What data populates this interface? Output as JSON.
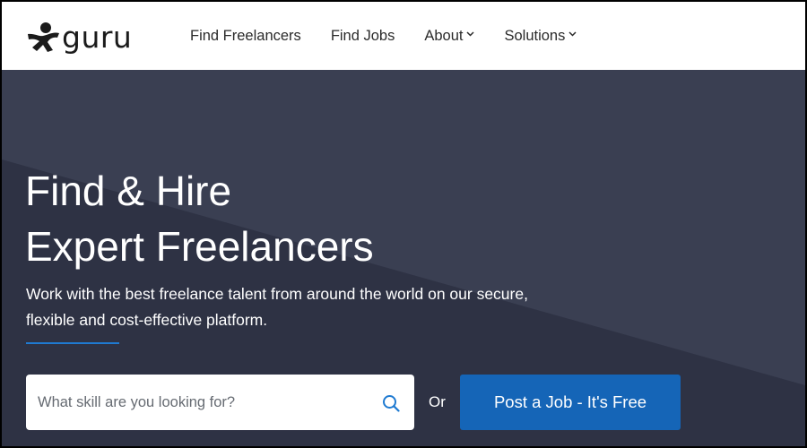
{
  "brand": {
    "name": "guru"
  },
  "nav": {
    "items": [
      {
        "label": "Find Freelancers",
        "has_dropdown": false
      },
      {
        "label": "Find Jobs",
        "has_dropdown": false
      },
      {
        "label": "About",
        "has_dropdown": true
      },
      {
        "label": "Solutions",
        "has_dropdown": true
      }
    ]
  },
  "hero": {
    "title_line1": "Find & Hire",
    "title_line2": "Expert Freelancers",
    "subtitle_line1": "Work with the best freelance talent from around the world on our secure,",
    "subtitle_line2": "flexible and cost-effective platform."
  },
  "search": {
    "placeholder": "What skill are you looking for?",
    "value": ""
  },
  "cta": {
    "or_text": "Or",
    "post_job_label": "Post a Job - It's Free"
  },
  "colors": {
    "hero_bg": "#383d4f",
    "hero_bg_dark": "#2e3244",
    "accent": "#1565b7",
    "rule": "#1f7ad1"
  }
}
